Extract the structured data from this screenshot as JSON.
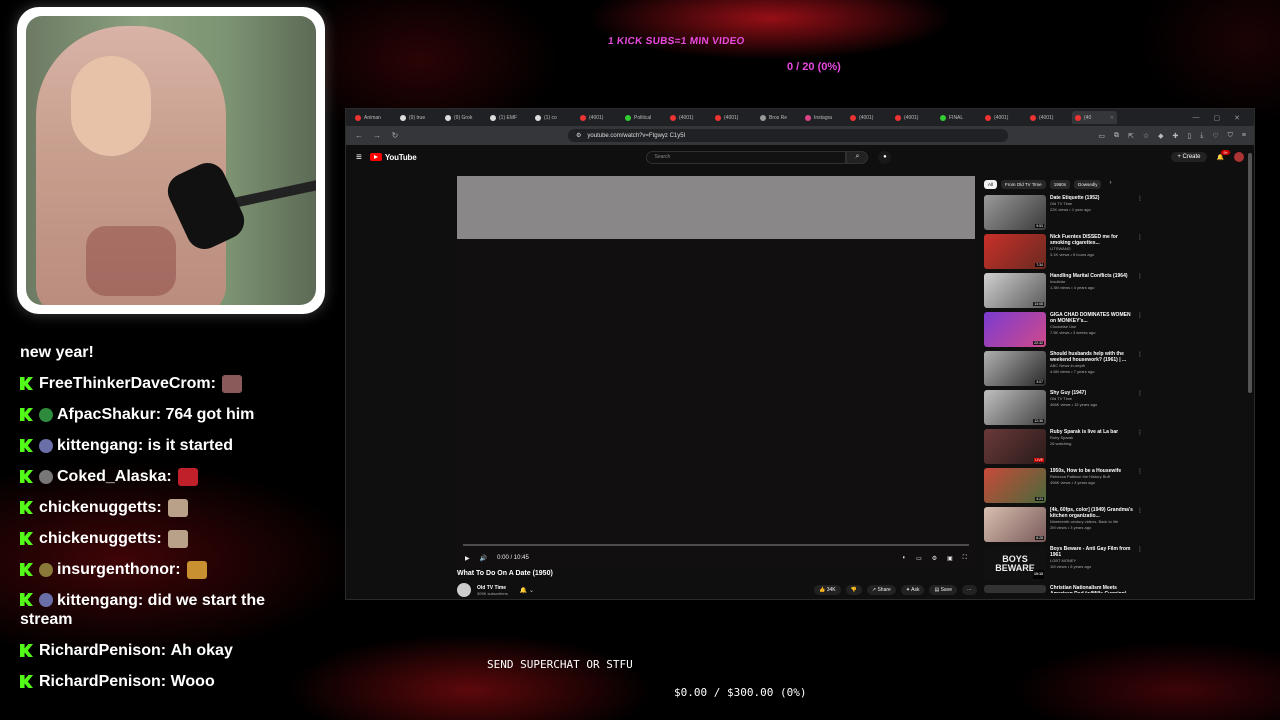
{
  "overlay": {
    "sub_goal": "1 KICK SUBS=1 MIN VIDEO",
    "sub_progress": "0 / 20 (0%)",
    "superchat_label": "SEND SUPERCHAT OR STFU",
    "superchat_goal": "$0.00 / $300.00 (0%)"
  },
  "chat": {
    "messages": [
      {
        "user": "",
        "text": "new year!"
      },
      {
        "user": "FreeThinkerDaveCrom:",
        "text": ""
      },
      {
        "user": "AfpacShakur:",
        "text": "764 got him"
      },
      {
        "user": "kittengang:",
        "text": "is it started"
      },
      {
        "user": "Coked_Alaska:",
        "text": ""
      },
      {
        "user": "chickenuggetts:",
        "text": ""
      },
      {
        "user": "chickenuggetts:",
        "text": ""
      },
      {
        "user": "insurgenthonor:",
        "text": ""
      },
      {
        "user": "kittengang:",
        "text": "did we start the stream"
      },
      {
        "user": "RichardPenison:",
        "text": "Ah okay"
      },
      {
        "user": "RichardPenison:",
        "text": "Wooo"
      }
    ]
  },
  "browser": {
    "tabs": [
      "Animan",
      "(9) true",
      "(9) Grok",
      "(1) EMF",
      "(1) co",
      "(4001)",
      "Political",
      "(4001)",
      "(4001)",
      "Bros Re",
      "Instagra",
      "(4001)",
      "(4001)",
      "FINAL",
      "(4001)",
      "(4001)",
      "(40"
    ],
    "url": "youtube.com/watch?v=Ftgwyz C1y5I"
  },
  "youtube": {
    "logo": "YouTube",
    "search_placeholder": "Search",
    "create_label": "Create",
    "bell_count": "9+",
    "video": {
      "time": "0:00 / 10:45",
      "progress": 0.0,
      "title": "What To Do On A Date (1950)",
      "channel": "Old TV Time",
      "subscribers": "309K subscribers",
      "likes": "34K",
      "share": "Share",
      "ask": "Ask",
      "save": "Save"
    },
    "chips": [
      "All",
      "From Old TV Time",
      "1950s",
      "Dowsedly"
    ],
    "recs": [
      {
        "title": "Date Etiquette (1952)",
        "channel": "Old TV Time",
        "meta": "22K views • 1 year ago",
        "dur": "9:53"
      },
      {
        "title": "Nick Fuentes DISSED me for smoking cigarettes...",
        "channel": "LITSWANG",
        "meta": "3.1K views • 6 hours ago",
        "dur": "7:34"
      },
      {
        "title": "Handling Marital Conflicts (1964)",
        "channel": "Insolidar",
        "meta": "1.3M views • 4 years ago",
        "dur": "14:08"
      },
      {
        "title": "GIGA CHAD DOMINATES WOMEN on MONKEY's...",
        "channel": "Clockwise Use",
        "meta": "7.5K views • 3 weeks ago",
        "dur": "22:32"
      },
      {
        "title": "Should husbands help with the weekend housework? (1961) | ...",
        "channel": "ABC News In-depth",
        "meta": "4.6M views • 7 years ago",
        "dur": "3:07"
      },
      {
        "title": "Shy Guy (1947)",
        "channel": "Old TV Time",
        "meta": "466K views • 15 years ago",
        "dur": "12:36"
      },
      {
        "title": "Ruby Sparak is live at La bar",
        "channel": "Ruby Sparak",
        "meta": "26 watching",
        "dur": "LIVE"
      },
      {
        "title": "1950s, How to be a Housewife",
        "channel": "Rebecca Pattison the History Buff",
        "meta": "496K views • 3 years ago",
        "dur": "4:24"
      },
      {
        "title": "[4k, 60fps, color] (1949) Grandma's kitchen organizatio...",
        "channel": "Nineteenth century videos. Back to life",
        "meta": "2M views • 3 years ago",
        "dur": "6:28"
      },
      {
        "title": "Boys Beware - Anti Gay Film from 1961",
        "channel": "LGBT MONEY",
        "meta": "1M views • 8 years ago",
        "dur": "10:13"
      },
      {
        "title": "Christian Nationalism Meets American Dad (w/Mills Cunning)",
        "channel": "",
        "meta": "",
        "dur": ""
      }
    ]
  },
  "colors": {
    "accent_pink": "#e84ae0",
    "kick_green": "#53fc18",
    "yt_red": "#ff0000"
  }
}
